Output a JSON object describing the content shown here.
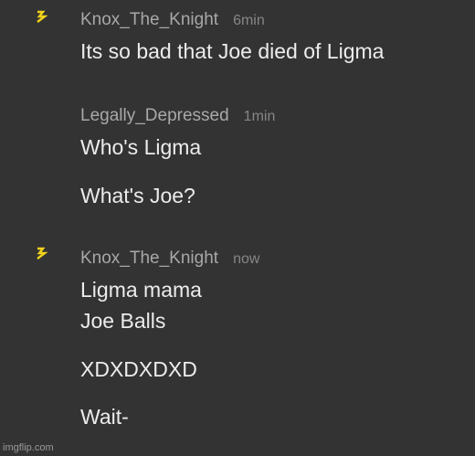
{
  "colors": {
    "background": "#333333",
    "username": "#a8a8a8",
    "timestamp": "#868686",
    "message_text": "#ececec",
    "lightning_icon": "#f2d21b"
  },
  "messages": [
    {
      "icon": "lightning-bolt-icon",
      "username": "Knox_The_Knight",
      "time": "6min",
      "lines": [
        "Its so bad that Joe died of Ligma"
      ]
    },
    {
      "username": "Legally_Depressed",
      "time": "1min",
      "lines": [
        "Who's Ligma",
        "What's Joe?"
      ]
    },
    {
      "icon": "lightning-bolt-icon",
      "username": "Knox_The_Knight",
      "time": "now",
      "lines": [
        "Ligma mama",
        "Joe Balls",
        "XDXDXDXD",
        "Wait-"
      ]
    }
  ],
  "watermark": "imgflip.com"
}
